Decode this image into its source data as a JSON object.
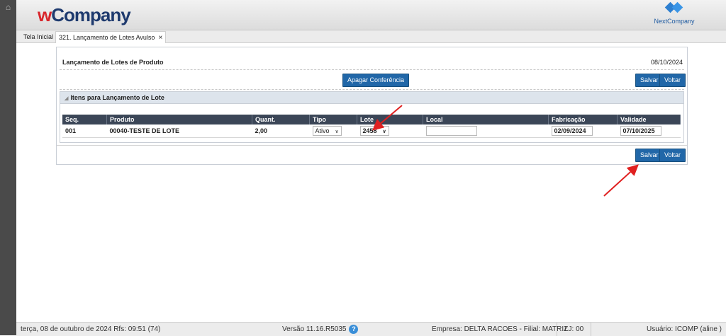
{
  "header": {
    "logo_w": "w",
    "logo_rest": "Company",
    "next_logo_label": "NextCompany"
  },
  "tabs": [
    {
      "label": "Tela Inicial"
    },
    {
      "label": "321. Lançamento de Lotes Avulso",
      "close": "×"
    }
  ],
  "panel": {
    "title": "Lançamento de Lotes de Produto",
    "date": "08/10/2024",
    "apagar_label": "Apagar Conferência",
    "salvar_label": "Salvar",
    "voltar_label": "Voltar",
    "section_title": "Itens para Lançamento de Lote"
  },
  "grid": {
    "columns": [
      "Seq.",
      "Produto",
      "Quant.",
      "Tipo",
      "Lote",
      "Local",
      "Fabricação",
      "Validade"
    ],
    "rows": [
      {
        "seq": "001",
        "produto": "00040-TESTE DE LOTE",
        "quant": "2,00",
        "tipo": "Ativo",
        "lote": "2458",
        "local": "",
        "fabricacao": "02/09/2024",
        "validade": "07/10/2025"
      }
    ]
  },
  "status": {
    "date": "terça, 08 de outubro de 2024  Rfs: 09:51 (74)",
    "version": "Versão 11.16.R5035",
    "help": "?",
    "empresa": "Empresa: DELTA RACOES - Filial: MATRIZ",
    "lj": "LJ: 00",
    "usuario": "Usuário: ICOMP (aline )"
  },
  "colors": {
    "button": "#2167a8",
    "grid_header": "#3b4657",
    "arrow": "#e02020",
    "logo_red": "#d8262c",
    "logo_blue": "#1e3a6e"
  }
}
